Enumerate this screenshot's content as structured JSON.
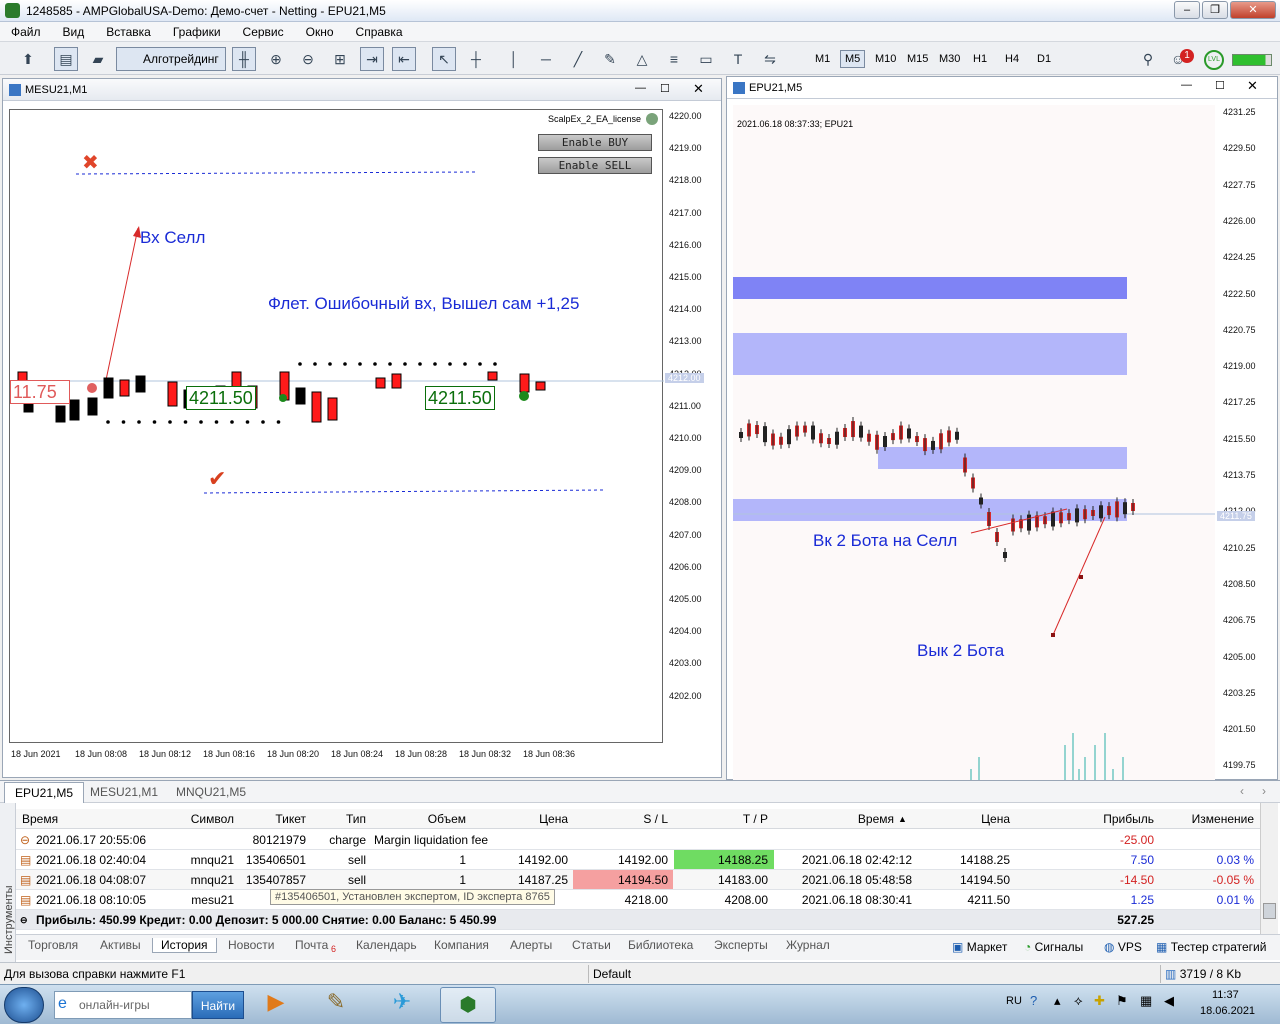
{
  "window": {
    "title": "1248585 - AMPGlobalUSA-Demo: Демо-счет - Netting - EPU21,M5"
  },
  "menu": [
    "Файл",
    "Вид",
    "Вставка",
    "Графики",
    "Сервис",
    "Окно",
    "Справка"
  ],
  "toolbar": {
    "algo_label": "Алготрейдинг",
    "timeframes": [
      "M1",
      "M5",
      "M10",
      "M15",
      "M30",
      "H1",
      "H4",
      "D1"
    ],
    "active_tf": "M5",
    "notif_count": "1",
    "lvl": "LVL"
  },
  "left_chart": {
    "title": "MESU21,M1",
    "ea_name": "ScalpEx_2_EA_license",
    "btn_buy": "Enable BUY",
    "btn_sell": "Enable SELL",
    "text_entry": "Вх Селл",
    "text_flat": "Флет. Ошибочный вх, Вышел сам +1,25",
    "label_a": "4211.50",
    "label_b": "4211.50",
    "label_red": "11.75",
    "price_current": "4212.00",
    "prices": [
      "4220.00",
      "4219.00",
      "4218.00",
      "4217.00",
      "4216.00",
      "4215.00",
      "4214.00",
      "4213.00",
      "4212.00",
      "4211.00",
      "4210.00",
      "4209.00",
      "4208.00",
      "4207.00",
      "4206.00",
      "4205.00",
      "4204.00",
      "4203.00",
      "4202.00"
    ],
    "times": [
      "18 Jun 2021",
      "18 Jun 08:08",
      "18 Jun 08:12",
      "18 Jun 08:16",
      "18 Jun 08:20",
      "18 Jun 08:24",
      "18 Jun 08:28",
      "18 Jun 08:32",
      "18 Jun 08:36"
    ]
  },
  "right_chart": {
    "title": "EPU21,M5",
    "header": "2021.06.18 08:37:33; EPU21",
    "text_entry": "Вк 2 Бота на Селл",
    "text_exit": "Вык 2 Бота",
    "price_current": "4211.75",
    "prices": [
      "4231.25",
      "4229.50",
      "4227.75",
      "4226.00",
      "4224.25",
      "4222.50",
      "4220.75",
      "4219.00",
      "4217.25",
      "4215.50",
      "4213.75",
      "4212.00",
      "4210.25",
      "4208.50",
      "4206.75",
      "4205.00",
      "4203.25",
      "4201.50",
      "4199.75"
    ]
  },
  "chart_tabs": [
    "EPU21,M5",
    "MESU21,M1",
    "MNQU21,M5"
  ],
  "table": {
    "headers": [
      "Время",
      "Символ",
      "Тикет",
      "Тип",
      "Объем",
      "Цена",
      "S / L",
      "T / P",
      "Время",
      "Цена",
      "Прибыль",
      "Изменение"
    ],
    "rows": [
      {
        "time": "2021.06.17 20:55:06",
        "symbol": "",
        "ticket": "80121979",
        "type": "charge",
        "volume": "Margin liquidation fee",
        "price": "",
        "sl": "",
        "tp": "",
        "time2": "",
        "price2": "",
        "profit": "-25.00",
        "change": ""
      },
      {
        "time": "2021.06.18 02:40:04",
        "symbol": "mnqu21",
        "ticket": "135406501",
        "type": "sell",
        "volume": "1",
        "price": "14192.00",
        "sl": "14192.00",
        "tp": "14188.25",
        "time2": "2021.06.18 02:42:12",
        "price2": "14188.25",
        "profit": "7.50",
        "change": "0.03 %"
      },
      {
        "time": "2021.06.18 04:08:07",
        "symbol": "mnqu21",
        "ticket": "135407857",
        "type": "sell",
        "volume": "1",
        "price": "14187.25",
        "sl": "14194.50",
        "tp": "14183.00",
        "time2": "2021.06.18 05:48:58",
        "price2": "14194.50",
        "profit": "-14.50",
        "change": "-0.05 %"
      },
      {
        "time": "2021.06.18 08:10:05",
        "symbol": "mesu21",
        "ticket": "135",
        "type": "",
        "volume": "",
        "price": "",
        "sl": "4218.00",
        "tp": "4208.00",
        "time2": "2021.06.18 08:30:41",
        "price2": "4211.50",
        "profit": "1.25",
        "change": "0.01 %"
      }
    ],
    "tooltip": "#135406501, Установлен экспертом, ID эксперта 8765",
    "summary": "Прибыль: 450.99  Кредит: 0.00  Депозит: 5 000.00  Снятие: 0.00  Баланс: 5 450.99",
    "summary_total": "527.25"
  },
  "bottom_tabs": [
    "Торговля",
    "Активы",
    "История",
    "Новости",
    "Почта",
    "Календарь",
    "Компания",
    "Алерты",
    "Статьи",
    "Библиотека",
    "Эксперты",
    "Журнал"
  ],
  "mail_badge": "6",
  "bottom_right": [
    "Маркет",
    "Сигналы",
    "VPS",
    "Тестер стратегий"
  ],
  "side_label": "Инструменты",
  "status": {
    "help": "Для вызова справки нажмите F1",
    "profile": "Default",
    "traffic": "3719 / 8 Kb"
  },
  "taskbar": {
    "search": "онлайн-игры",
    "search_btn": "Найти",
    "lang": "RU",
    "time": "11:37",
    "date": "18.06.2021"
  }
}
